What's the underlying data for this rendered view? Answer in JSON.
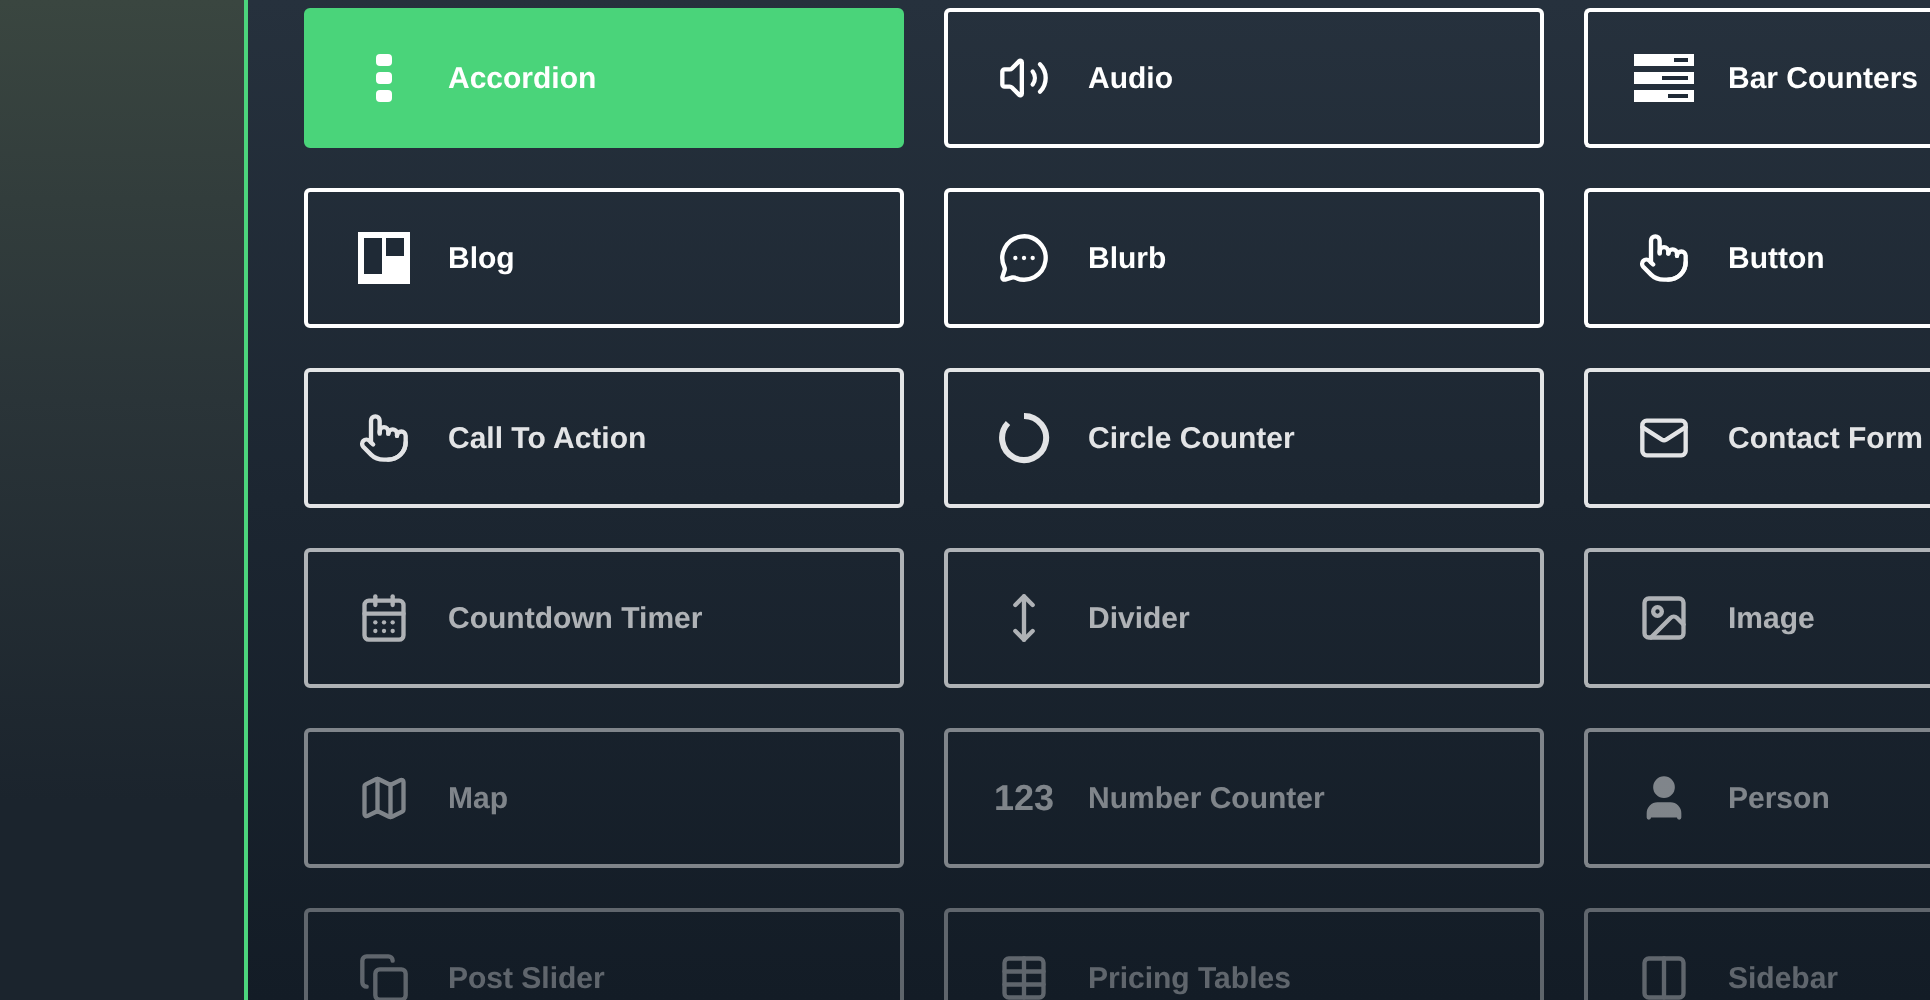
{
  "modules": [
    {
      "label": "Accordion",
      "selected": true
    },
    {
      "label": "Audio",
      "selected": false
    },
    {
      "label": "Bar Counters",
      "selected": false
    },
    {
      "label": "Blog",
      "selected": false
    },
    {
      "label": "Blurb",
      "selected": false
    },
    {
      "label": "Button",
      "selected": false
    },
    {
      "label": "Call To Action",
      "selected": false
    },
    {
      "label": "Circle Counter",
      "selected": false
    },
    {
      "label": "Contact Form",
      "selected": false
    },
    {
      "label": "Countdown Timer",
      "selected": false
    },
    {
      "label": "Divider",
      "selected": false
    },
    {
      "label": "Image",
      "selected": false
    },
    {
      "label": "Map",
      "selected": false
    },
    {
      "label": "Number Counter",
      "selected": false,
      "icon_text": "123"
    },
    {
      "label": "Person",
      "selected": false
    },
    {
      "label": "Post Slider",
      "selected": false
    },
    {
      "label": "Pricing Tables",
      "selected": false
    },
    {
      "label": "Sidebar",
      "selected": false
    }
  ]
}
